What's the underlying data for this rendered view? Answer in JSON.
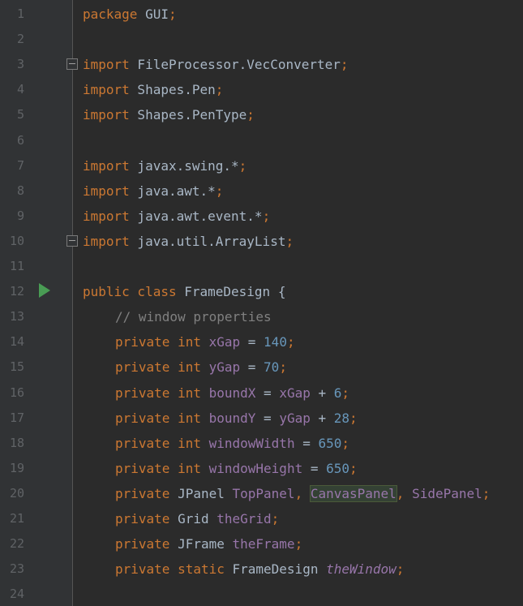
{
  "editor": {
    "colors": {
      "background": "#2b2b2b",
      "gutter": "#313335",
      "keyword": "#cc7832",
      "number": "#6897bb",
      "field": "#9876aa",
      "comment": "#808080",
      "text": "#a9b7c6",
      "run_icon": "#499c54"
    },
    "gutter_icons": {
      "fold": "fold-icon",
      "run": "run-gutter-icon"
    },
    "lines": [
      {
        "n": "1",
        "tokens": [
          {
            "t": "package",
            "c": "kw"
          },
          {
            "t": " GUI",
            "c": "ident"
          },
          {
            "t": ";",
            "c": "punc"
          }
        ]
      },
      {
        "n": "2",
        "tokens": []
      },
      {
        "n": "3",
        "tokens": [
          {
            "t": "import",
            "c": "kw"
          },
          {
            "t": " FileProcessor.VecConverter",
            "c": "ident"
          },
          {
            "t": ";",
            "c": "punc"
          }
        ]
      },
      {
        "n": "4",
        "tokens": [
          {
            "t": "import",
            "c": "kw"
          },
          {
            "t": " Shapes.Pen",
            "c": "ident"
          },
          {
            "t": ";",
            "c": "punc"
          }
        ]
      },
      {
        "n": "5",
        "tokens": [
          {
            "t": "import",
            "c": "kw"
          },
          {
            "t": " Shapes.PenType",
            "c": "ident"
          },
          {
            "t": ";",
            "c": "punc"
          }
        ]
      },
      {
        "n": "6",
        "tokens": []
      },
      {
        "n": "7",
        "tokens": [
          {
            "t": "import",
            "c": "kw"
          },
          {
            "t": " javax.swing.*",
            "c": "ident"
          },
          {
            "t": ";",
            "c": "punc"
          }
        ]
      },
      {
        "n": "8",
        "tokens": [
          {
            "t": "import",
            "c": "kw"
          },
          {
            "t": " java.awt.*",
            "c": "ident"
          },
          {
            "t": ";",
            "c": "punc"
          }
        ]
      },
      {
        "n": "9",
        "tokens": [
          {
            "t": "import",
            "c": "kw"
          },
          {
            "t": " java.awt.event.*",
            "c": "ident"
          },
          {
            "t": ";",
            "c": "punc"
          }
        ]
      },
      {
        "n": "10",
        "tokens": [
          {
            "t": "import",
            "c": "kw"
          },
          {
            "t": " java.util.ArrayList",
            "c": "ident"
          },
          {
            "t": ";",
            "c": "punc"
          }
        ]
      },
      {
        "n": "11",
        "tokens": []
      },
      {
        "n": "12",
        "tokens": [
          {
            "t": "public class",
            "c": "kw"
          },
          {
            "t": " FrameDesign {",
            "c": "ident"
          }
        ]
      },
      {
        "n": "13",
        "indent": true,
        "tokens": [
          {
            "t": "// window properties",
            "c": "comment"
          }
        ]
      },
      {
        "n": "14",
        "indent": true,
        "tokens": [
          {
            "t": "private int",
            "c": "kw"
          },
          {
            "t": " ",
            "c": "ident"
          },
          {
            "t": "xGap",
            "c": "field"
          },
          {
            "t": " = ",
            "c": "ident"
          },
          {
            "t": "140",
            "c": "num"
          },
          {
            "t": ";",
            "c": "punc"
          }
        ]
      },
      {
        "n": "15",
        "indent": true,
        "tokens": [
          {
            "t": "private int",
            "c": "kw"
          },
          {
            "t": " ",
            "c": "ident"
          },
          {
            "t": "yGap",
            "c": "field"
          },
          {
            "t": " = ",
            "c": "ident"
          },
          {
            "t": "70",
            "c": "num"
          },
          {
            "t": ";",
            "c": "punc"
          }
        ]
      },
      {
        "n": "16",
        "indent": true,
        "tokens": [
          {
            "t": "private int",
            "c": "kw"
          },
          {
            "t": " ",
            "c": "ident"
          },
          {
            "t": "boundX",
            "c": "field"
          },
          {
            "t": " = ",
            "c": "ident"
          },
          {
            "t": "xGap",
            "c": "field"
          },
          {
            "t": " + ",
            "c": "ident"
          },
          {
            "t": "6",
            "c": "num"
          },
          {
            "t": ";",
            "c": "punc"
          }
        ]
      },
      {
        "n": "17",
        "indent": true,
        "tokens": [
          {
            "t": "private int",
            "c": "kw"
          },
          {
            "t": " ",
            "c": "ident"
          },
          {
            "t": "boundY",
            "c": "field"
          },
          {
            "t": " = ",
            "c": "ident"
          },
          {
            "t": "yGap",
            "c": "field"
          },
          {
            "t": " + ",
            "c": "ident"
          },
          {
            "t": "28",
            "c": "num"
          },
          {
            "t": ";",
            "c": "punc"
          }
        ]
      },
      {
        "n": "18",
        "indent": true,
        "tokens": [
          {
            "t": "private int",
            "c": "kw"
          },
          {
            "t": " ",
            "c": "ident"
          },
          {
            "t": "windowWidth",
            "c": "field"
          },
          {
            "t": " = ",
            "c": "ident"
          },
          {
            "t": "650",
            "c": "num"
          },
          {
            "t": ";",
            "c": "punc"
          }
        ]
      },
      {
        "n": "19",
        "indent": true,
        "tokens": [
          {
            "t": "private int",
            "c": "kw"
          },
          {
            "t": " ",
            "c": "ident"
          },
          {
            "t": "windowHeight",
            "c": "field"
          },
          {
            "t": " = ",
            "c": "ident"
          },
          {
            "t": "650",
            "c": "num"
          },
          {
            "t": ";",
            "c": "punc"
          }
        ]
      },
      {
        "n": "20",
        "indent": true,
        "tokens": [
          {
            "t": "private",
            "c": "kw"
          },
          {
            "t": " JPanel ",
            "c": "ident"
          },
          {
            "t": "TopPanel",
            "c": "field"
          },
          {
            "t": ", ",
            "c": "punc"
          },
          {
            "t": "CanvasPanel",
            "c": "highlight"
          },
          {
            "t": ", ",
            "c": "punc"
          },
          {
            "t": "SidePanel",
            "c": "field"
          },
          {
            "t": ";",
            "c": "punc"
          }
        ]
      },
      {
        "n": "21",
        "indent": true,
        "tokens": [
          {
            "t": "private",
            "c": "kw"
          },
          {
            "t": " Grid ",
            "c": "ident"
          },
          {
            "t": "theGrid",
            "c": "field"
          },
          {
            "t": ";",
            "c": "punc"
          }
        ]
      },
      {
        "n": "22",
        "indent": true,
        "tokens": [
          {
            "t": "private",
            "c": "kw"
          },
          {
            "t": " JFrame ",
            "c": "ident"
          },
          {
            "t": "theFrame",
            "c": "field"
          },
          {
            "t": ";",
            "c": "punc"
          }
        ]
      },
      {
        "n": "23",
        "indent": true,
        "tokens": [
          {
            "t": "private static",
            "c": "kw"
          },
          {
            "t": " FrameDesign ",
            "c": "ident"
          },
          {
            "t": "theWindow",
            "c": "static"
          },
          {
            "t": ";",
            "c": "punc"
          }
        ]
      },
      {
        "n": "24",
        "tokens": []
      }
    ]
  }
}
